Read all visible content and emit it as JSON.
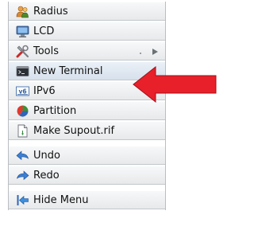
{
  "menu": {
    "items": [
      {
        "label": "Radius",
        "icon": "users-icon"
      },
      {
        "label": "LCD",
        "icon": "monitor-icon"
      },
      {
        "label": "Tools",
        "icon": "tools-icon",
        "submenu": true
      },
      {
        "label": "New Terminal",
        "icon": "terminal-icon",
        "highlighted": true
      },
      {
        "label": "IPv6",
        "icon": "ipv6-icon",
        "submenu": true
      },
      {
        "label": "Partition",
        "icon": "pie-chart-icon"
      },
      {
        "label": "Make Supout.rif",
        "icon": "document-icon"
      },
      {
        "label": "Undo",
        "icon": "undo-arrow-icon"
      },
      {
        "label": "Redo",
        "icon": "redo-arrow-icon"
      },
      {
        "label": "Hide Menu",
        "icon": "hide-menu-icon"
      }
    ],
    "icon_badge": "v6"
  },
  "annotation": {
    "icon": "red-arrow-icon",
    "color": "#e8202a"
  }
}
